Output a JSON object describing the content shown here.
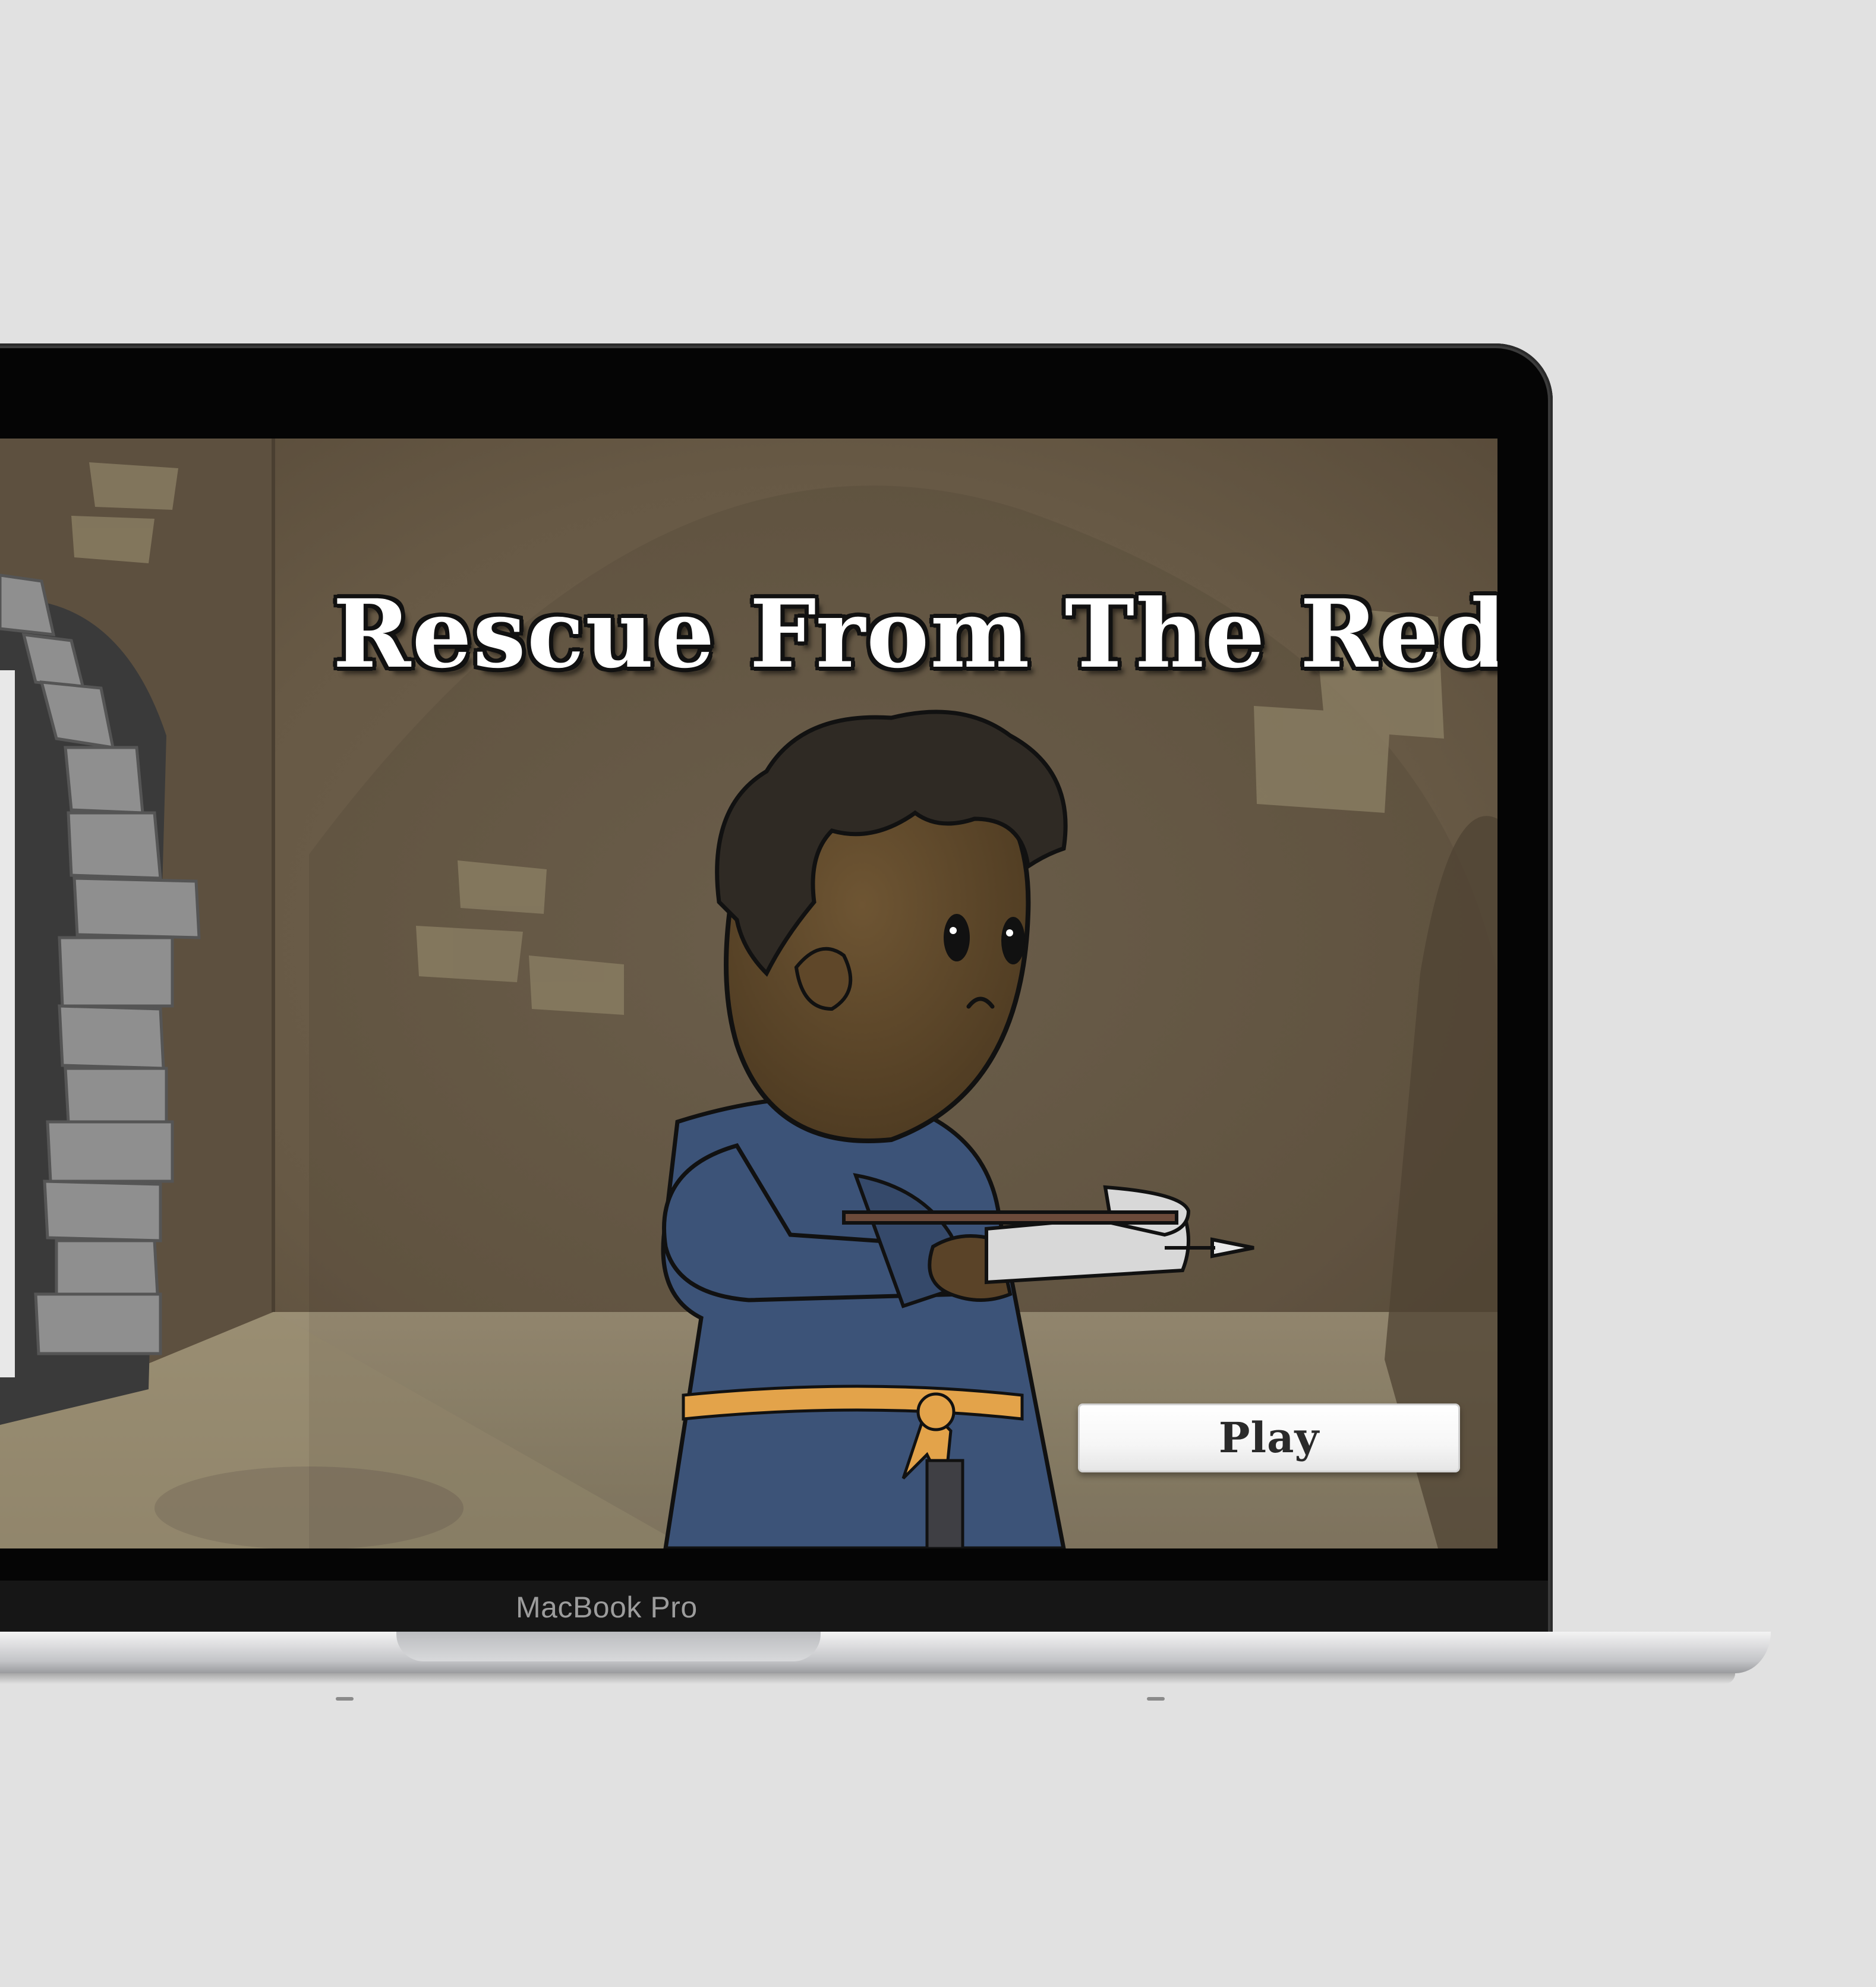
{
  "device": {
    "label": "MacBook Pro"
  },
  "game": {
    "title": "Rescue From The Red Keep",
    "play_button_label": "Play"
  },
  "colors": {
    "background": "#e1e1e1",
    "wall": "#6a5c49",
    "wall_dark": "#56493a",
    "floor": "#8e826a",
    "stone_arch": "#8a8a8a",
    "robe": "#3c5378",
    "belt": "#e3a34a",
    "skin": "#5a4328",
    "hair": "#2f2a24",
    "crossbow": "#d8d8d8"
  },
  "icons": {
    "character": "crossbow-character-icon",
    "arch": "stone-archway-icon"
  }
}
